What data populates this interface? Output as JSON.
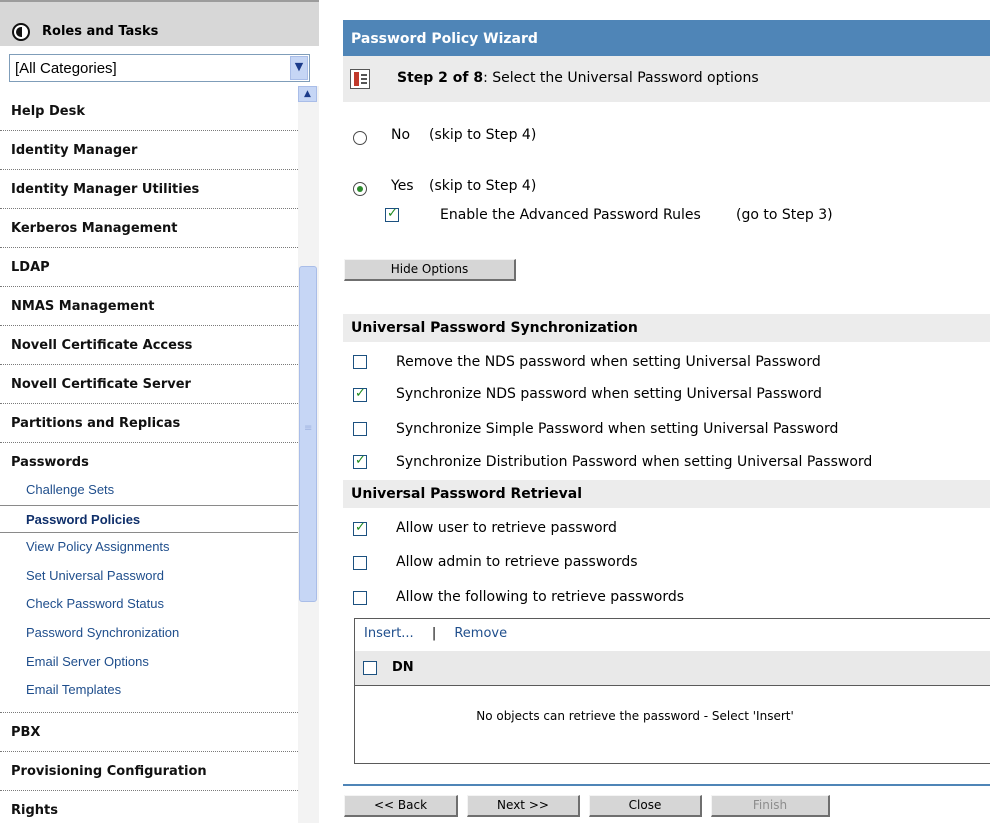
{
  "sidebar": {
    "title": "Roles and Tasks",
    "category_select": {
      "value": "[All Categories]"
    },
    "categories": [
      {
        "label": "Help Desk"
      },
      {
        "label": "Identity Manager"
      },
      {
        "label": "Identity Manager Utilities"
      },
      {
        "label": "Kerberos Management"
      },
      {
        "label": "LDAP"
      },
      {
        "label": "NMAS Management"
      },
      {
        "label": "Novell Certificate Access"
      },
      {
        "label": "Novell Certificate Server"
      },
      {
        "label": "Partitions and Replicas"
      },
      {
        "label": "Passwords"
      },
      {
        "label": "PBX"
      },
      {
        "label": "Provisioning Configuration"
      },
      {
        "label": "Rights"
      }
    ],
    "password_tasks": [
      {
        "label": "Challenge Sets"
      },
      {
        "label": "Password Policies",
        "selected": true
      },
      {
        "label": "View Policy Assignments"
      },
      {
        "label": "Set Universal Password"
      },
      {
        "label": "Check Password Status"
      },
      {
        "label": "Password Synchronization"
      },
      {
        "label": "Email Server Options"
      },
      {
        "label": "Email Templates"
      }
    ]
  },
  "wizard": {
    "title": "Password Policy Wizard",
    "step_label": "Step 2 of 8",
    "step_desc": ": Select the Universal Password options",
    "options": {
      "no": {
        "label": "No",
        "hint": "(skip to Step 4)",
        "selected": false
      },
      "yes": {
        "label": "Yes",
        "hint": "(skip to Step 4)",
        "selected": true
      },
      "advanced": {
        "label": "Enable the Advanced Password Rules",
        "hint": "(go to Step 3)",
        "checked": true
      }
    },
    "hide_options_label": "Hide Options",
    "sync": {
      "heading": "Universal Password Synchronization",
      "items": [
        {
          "label": "Remove the NDS password when setting Universal Password",
          "checked": false
        },
        {
          "label": "Synchronize NDS password when setting Universal Password",
          "checked": true
        },
        {
          "label": "Synchronize Simple Password when setting Universal Password",
          "checked": false
        },
        {
          "label": "Synchronize Distribution Password when setting Universal Password",
          "checked": true
        }
      ]
    },
    "retrieval": {
      "heading": "Universal Password Retrieval",
      "items": [
        {
          "label": "Allow user to retrieve password",
          "checked": true
        },
        {
          "label": "Allow admin to retrieve passwords",
          "checked": false
        },
        {
          "label": "Allow the following to retrieve passwords",
          "checked": false
        }
      ]
    },
    "dn_table": {
      "insert_label": "Insert...",
      "separator": "|",
      "remove_label": "Remove",
      "column_header": "DN",
      "empty_message": "No objects can retrieve the password - Select 'Insert'"
    },
    "buttons": {
      "back": "<< Back",
      "next": "Next >>",
      "close": "Close",
      "finish": "Finish"
    }
  }
}
